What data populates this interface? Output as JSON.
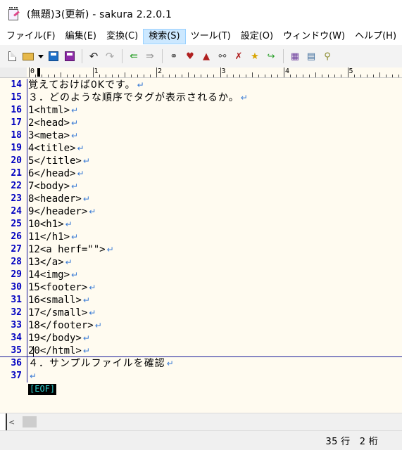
{
  "window": {
    "title": "(無題)3(更新) - sakura 2.2.0.1",
    "icon": "sakura-notepad-icon"
  },
  "menu": {
    "items": [
      {
        "label": "ファイル(F)"
      },
      {
        "label": "編集(E)"
      },
      {
        "label": "変換(C)"
      },
      {
        "label": "検索(S)"
      },
      {
        "label": "ツール(T)"
      },
      {
        "label": "設定(O)"
      },
      {
        "label": "ウィンドウ(W)"
      },
      {
        "label": "ヘルプ(H)"
      }
    ],
    "active_index": 3
  },
  "toolbar": {
    "buttons": [
      {
        "name": "new-file-icon"
      },
      {
        "name": "open-file-icon"
      },
      {
        "name": "open-dropdown-icon"
      },
      {
        "name": "save-icon"
      },
      {
        "name": "save-as-icon"
      },
      {
        "name": "undo-icon"
      },
      {
        "name": "redo-icon"
      },
      {
        "name": "jump-back-icon"
      },
      {
        "name": "jump-forward-icon"
      },
      {
        "name": "find-icon"
      },
      {
        "name": "find-next-icon"
      },
      {
        "name": "find-prev-icon"
      },
      {
        "name": "replace-icon"
      },
      {
        "name": "search-clear-icon"
      },
      {
        "name": "bookmark-icon"
      },
      {
        "name": "mark-jump-icon"
      },
      {
        "name": "grep-icon"
      },
      {
        "name": "compare-icon"
      },
      {
        "name": "tag-jump-icon"
      }
    ]
  },
  "ruler": {
    "labels": [
      "0",
      "1",
      "2",
      "3",
      "4",
      "5"
    ]
  },
  "editor": {
    "lines": [
      {
        "no": "14",
        "text": "覚えておけば0Kです。",
        "wide": true
      },
      {
        "no": "15",
        "text": "３．どのような順序でタグが表示されるか。",
        "wide": true
      },
      {
        "no": "16",
        "text": "1<html>"
      },
      {
        "no": "17",
        "text": "2<head>"
      },
      {
        "no": "18",
        "text": "3<meta>"
      },
      {
        "no": "19",
        "text": "4<title>"
      },
      {
        "no": "20",
        "text": "5</title>"
      },
      {
        "no": "21",
        "text": "6</head>"
      },
      {
        "no": "22",
        "text": "7<body>"
      },
      {
        "no": "23",
        "text": "8<header>"
      },
      {
        "no": "24",
        "text": "9</header>"
      },
      {
        "no": "25",
        "text": "10<h1>"
      },
      {
        "no": "26",
        "text": "11</h1>"
      },
      {
        "no": "27",
        "text": "12<a herf=\"\">"
      },
      {
        "no": "28",
        "text": "13</a>"
      },
      {
        "no": "29",
        "text": "14<img>"
      },
      {
        "no": "30",
        "text": "15<footer>"
      },
      {
        "no": "31",
        "text": "16<small>"
      },
      {
        "no": "32",
        "text": "17</small>"
      },
      {
        "no": "33",
        "text": "18</footer>"
      },
      {
        "no": "34",
        "text": "19</body>"
      },
      {
        "no": "35",
        "text": "20</html>",
        "cursor": true
      },
      {
        "no": "36",
        "text": "４．サンプルファイルを確認",
        "wide": true
      },
      {
        "no": "37",
        "text": ""
      }
    ],
    "newline_mark": "↵",
    "eof_label": "[EOF]"
  },
  "status": {
    "position": "35 行　2 桁"
  },
  "colors": {
    "editor_background": "#fffbf0",
    "line_number": "#0000c0",
    "newline_mark": "#3a7bd5",
    "eof_text": "#2fd3d3",
    "menu_active": "#cce8ff"
  }
}
